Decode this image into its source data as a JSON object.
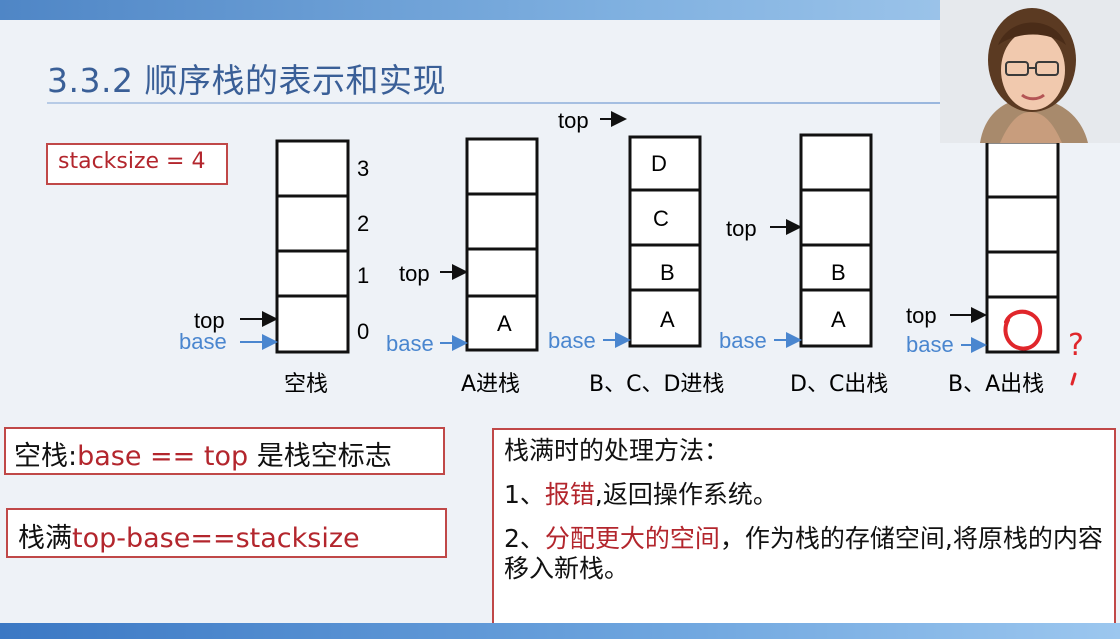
{
  "slide": {
    "title": "3.3.2 顺序栈的表示和实现",
    "stacksize_label": "stacksize = 4"
  },
  "stacks": [
    {
      "caption": "空栈",
      "cells": [
        "",
        "",
        "",
        ""
      ],
      "index_labels": [
        "3",
        "2",
        "1",
        "0"
      ],
      "top_label": "top",
      "base_label": "base"
    },
    {
      "caption": "A进栈",
      "cells": [
        "",
        "",
        "",
        "A"
      ],
      "top_label": "top",
      "base_label": "base"
    },
    {
      "caption": "B、C、D进栈",
      "cells": [
        "D",
        "C",
        "B",
        "A"
      ],
      "top_label": "top",
      "base_label": "base"
    },
    {
      "caption": "D、C出栈",
      "cells": [
        "",
        "",
        "B",
        "A"
      ],
      "top_label": "top",
      "base_label": "base"
    },
    {
      "caption": "B、A出栈",
      "cells": [
        "",
        "",
        "",
        ""
      ],
      "top_label": "top",
      "base_label": "base"
    }
  ],
  "annotations": {
    "question_mark": "?"
  },
  "notes": {
    "empty_prefix": "空栈:",
    "empty_red": "base == top",
    "empty_suffix": " 是栈空标志",
    "full_prefix": "栈满",
    "full_red": "top-base==stacksize"
  },
  "full_handling": {
    "heading": "栈满时的处理方法：",
    "item1_prefix": "1、",
    "item1_red": "报错",
    "item1_rest": ",返回操作系统。",
    "item2_prefix": "2、",
    "item2_red": "分配更大的空间",
    "item2_rest": "，作为栈的存储空间,将原栈的内容移入新栈。"
  },
  "colors": {
    "title": "#3a5f97",
    "accent_red": "#b3262d",
    "base_blue": "#4a86cf",
    "box_border": "#c04848",
    "ink_red": "#e0262b"
  }
}
